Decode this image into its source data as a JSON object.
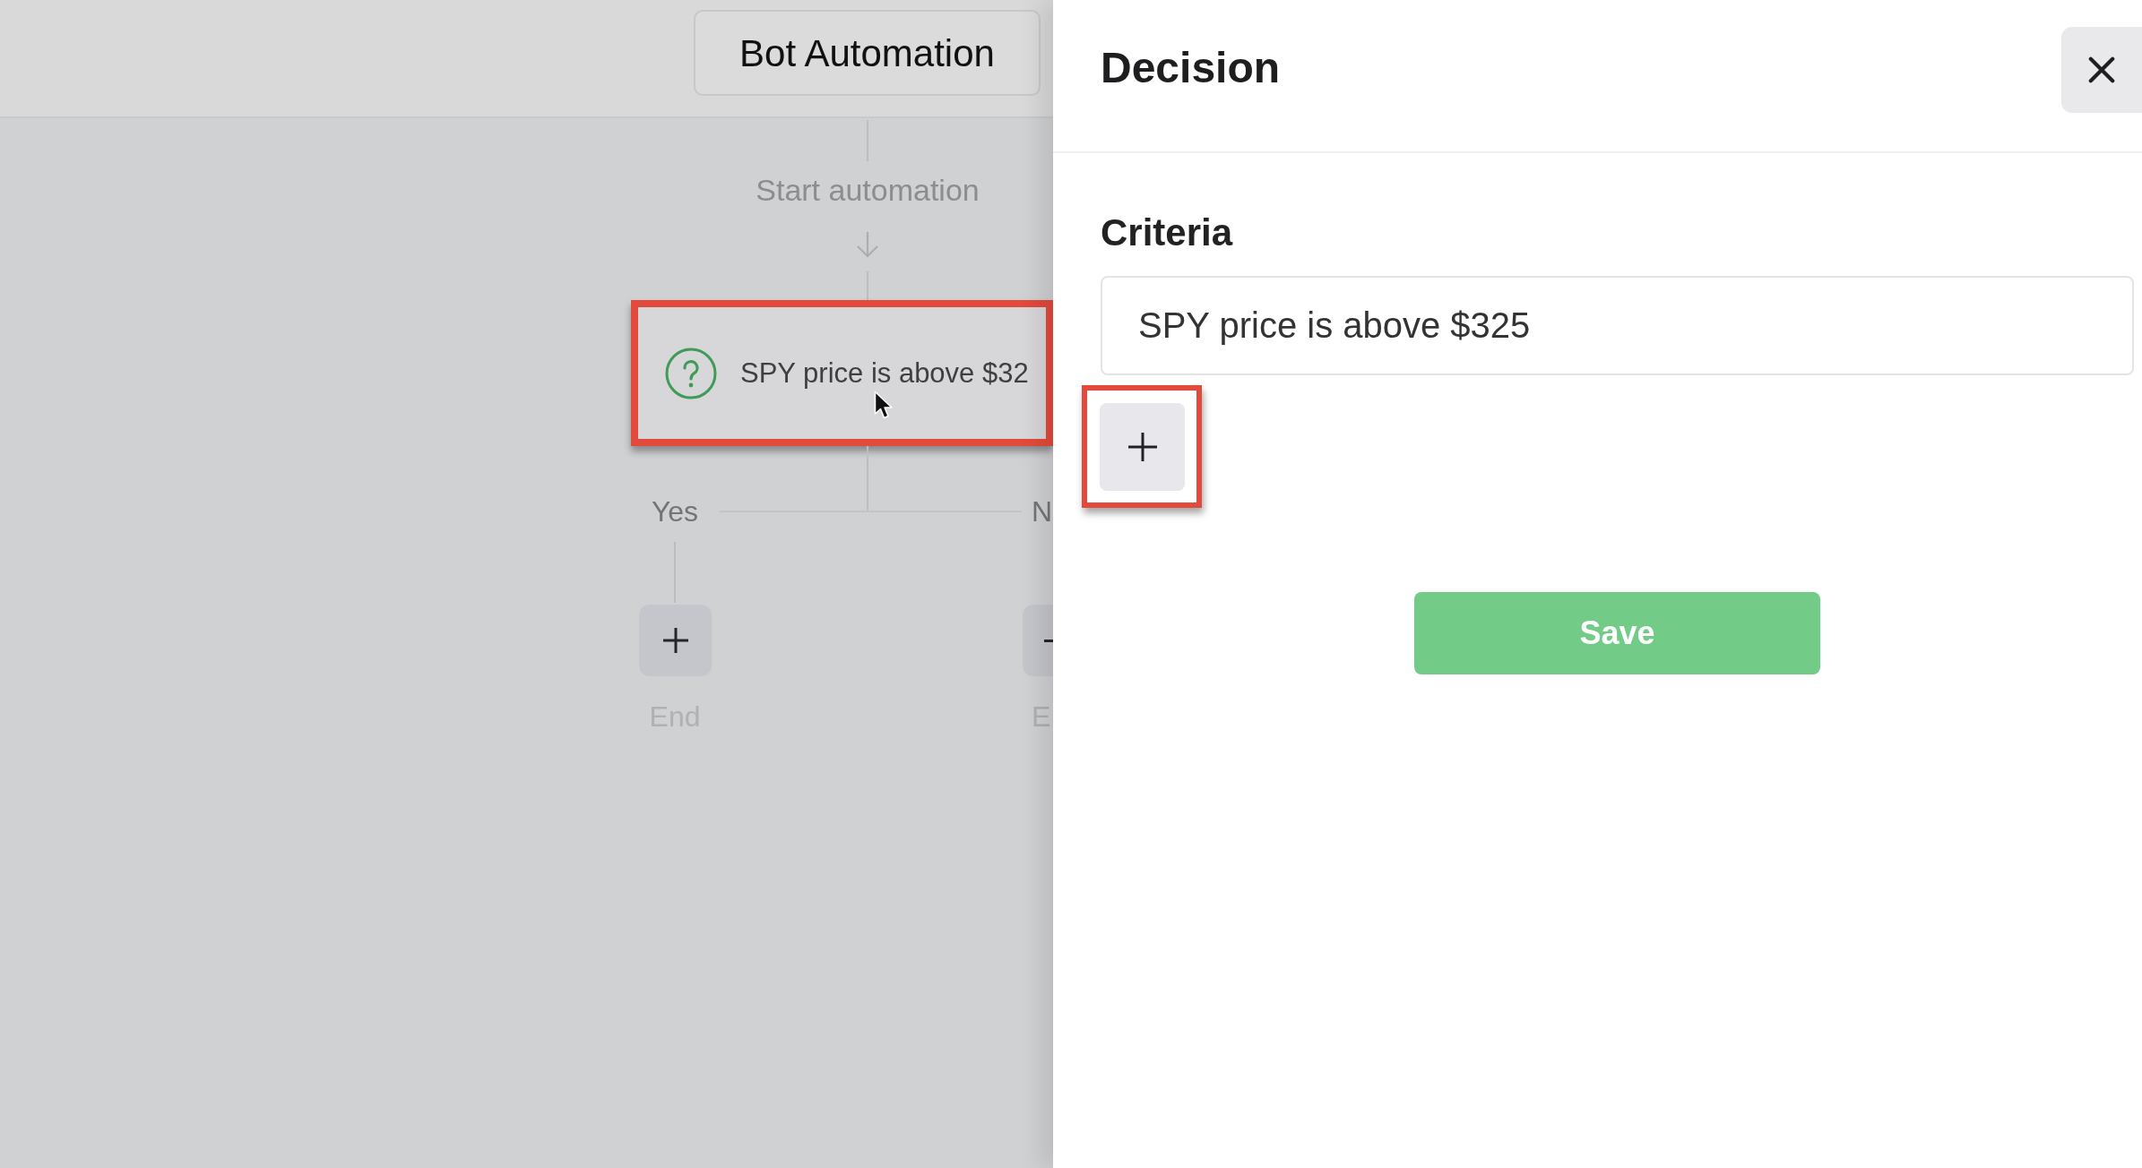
{
  "header": {
    "title_button": "Bot Automation"
  },
  "flow": {
    "start_label": "Start automation",
    "decision_node": {
      "text": "SPY price is above $32",
      "highlighted": true
    },
    "branches": [
      {
        "label": "Yes",
        "end_label": "End"
      },
      {
        "label": "N",
        "end_label": "E"
      }
    ]
  },
  "panel": {
    "title": "Decision",
    "criteria_label": "Criteria",
    "criteria": [
      {
        "value": "SPY price is above $325"
      }
    ],
    "add_criteria_button": {
      "highlighted": true
    },
    "save_button": "Save"
  }
}
